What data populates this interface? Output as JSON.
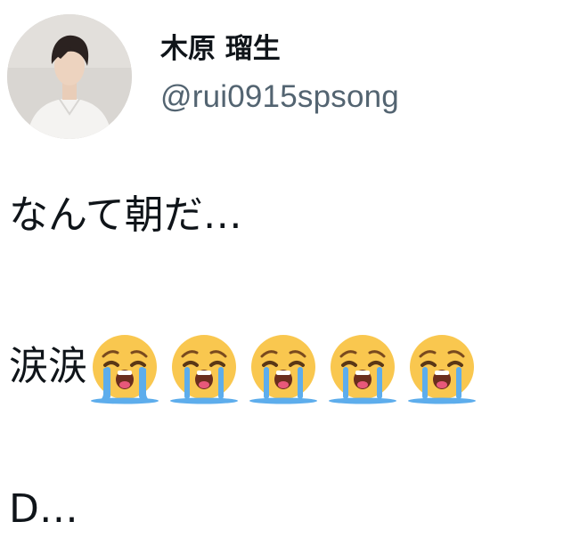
{
  "user": {
    "display_name": "木原 瑠生",
    "handle": "@rui0915spsong"
  },
  "tweet": {
    "line1": "なんて朝だ…",
    "line2_text": "涙涙",
    "line2_emoji": [
      "loudly-crying-face",
      "loudly-crying-face",
      "loudly-crying-face",
      "loudly-crying-face",
      "loudly-crying-face"
    ],
    "line3": "D…"
  },
  "colors": {
    "text": "#0f1419",
    "handle": "#536471",
    "emoji_face": "#f9c74f",
    "emoji_tears": "#5dadec"
  }
}
